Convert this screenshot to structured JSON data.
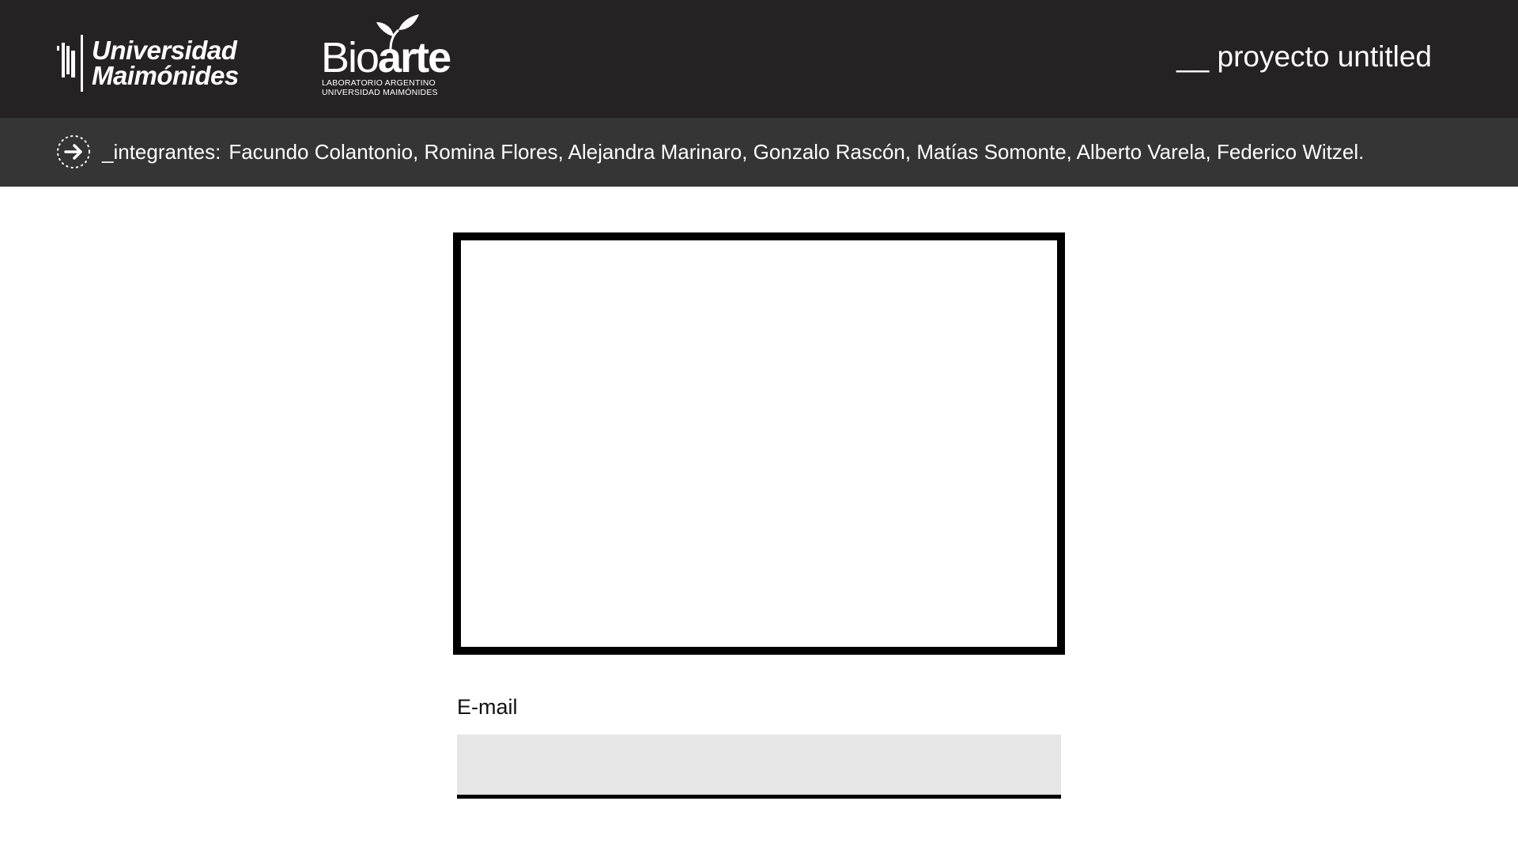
{
  "header": {
    "university_logo": {
      "line1": "Universidad",
      "line2": "Maimónides",
      "icon": "university-maimonides-mark-icon"
    },
    "bioarte_logo": {
      "word_light": "Bio",
      "word_bold": "arte",
      "subtitle_line1": "LABORATORIO ARGENTINO",
      "subtitle_line2": "UNIVERSIDAD MAIMÓNIDES",
      "icon": "plant-sprout-icon"
    },
    "project_title": "__ proyecto untitled"
  },
  "members_bar": {
    "icon": "arrow-right-circle-icon",
    "label": "_integrantes:",
    "names": "Facundo Colantonio, Romina Flores,  Alejandra Marinaro,  Gonzalo Rascón, Matías Somonte, Alberto Varela, Federico Witzel."
  },
  "main": {
    "email_label": "E-mail",
    "email_value": "",
    "email_placeholder": ""
  },
  "colors": {
    "header_bg": "#252223",
    "members_bar_bg": "#353535",
    "input_bg": "#e6e6e6",
    "frame_border": "#000000"
  }
}
